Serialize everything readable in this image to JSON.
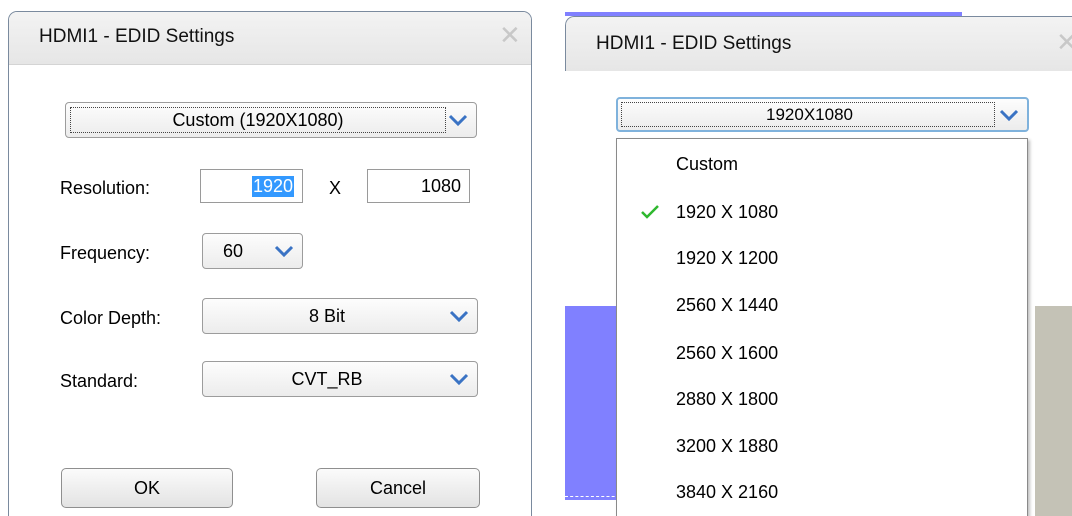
{
  "left_dialog": {
    "title": "HDMI1 - EDID Settings",
    "close_glyph": "✕",
    "preset_combo": {
      "value": "Custom (1920X1080)"
    },
    "resolution": {
      "label": "Resolution:",
      "width": "1920",
      "separator": "X",
      "height": "1080"
    },
    "frequency": {
      "label": "Frequency:",
      "value": "60"
    },
    "color_depth": {
      "label": "Color Depth:",
      "value": "8 Bit"
    },
    "standard": {
      "label": "Standard:",
      "value": "CVT_RB"
    },
    "ok_label": "OK",
    "cancel_label": "Cancel"
  },
  "right_dialog": {
    "title": "HDMI1 - EDID Settings",
    "close_glyph": "✕",
    "preset_combo": {
      "value": "1920X1080"
    },
    "dropdown_items": [
      {
        "label": "Custom",
        "checked": false
      },
      {
        "label": "1920 X 1080",
        "checked": true
      },
      {
        "label": "1920 X 1200",
        "checked": false
      },
      {
        "label": "2560 X 1440",
        "checked": false
      },
      {
        "label": "2560 X 1600",
        "checked": false
      },
      {
        "label": "2880 X 1800",
        "checked": false
      },
      {
        "label": "3200 X 1880",
        "checked": false
      },
      {
        "label": "3840 X 2160",
        "checked": false
      }
    ]
  },
  "colors": {
    "chevron": "#3a73c4",
    "selection": "#3399ff",
    "checkmark": "#2eb82e",
    "background_purple": "#8080ff",
    "background_gray": "#c4c2b6",
    "focus_border": "#7fb2dc"
  },
  "icons": [
    "close-icon",
    "chevron-down-icon",
    "checkmark-icon"
  ]
}
